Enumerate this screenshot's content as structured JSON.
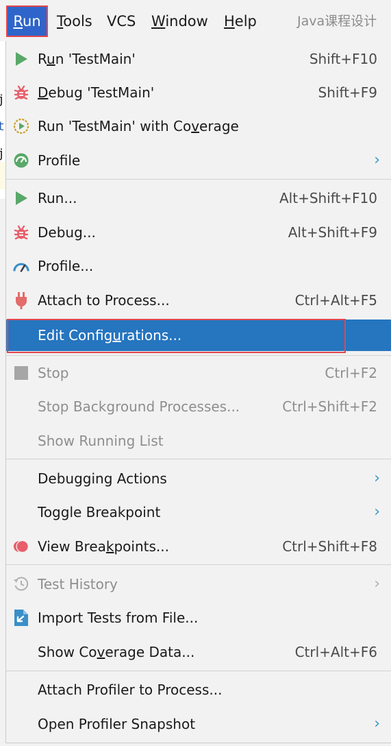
{
  "menubar": {
    "items": [
      {
        "label": "Run",
        "mnemonic": "R",
        "rest": "un"
      },
      {
        "label": "Tools",
        "mnemonic": "T",
        "rest": "ools"
      },
      {
        "label": "VCS"
      },
      {
        "label": "Window",
        "mnemonic": "W",
        "rest": "indow"
      },
      {
        "label": "Help",
        "mnemonic": "H",
        "rest": "elp"
      }
    ],
    "project_title": "Java课程设计"
  },
  "editor_fragments": [
    "j",
    "t",
    "j"
  ],
  "menu": {
    "items": [
      {
        "pre": "R",
        "mn": "u",
        "post": "n 'TestMain'",
        "shortcut": "Shift+F10",
        "icon": "run-icon"
      },
      {
        "pre": "",
        "mn": "D",
        "post": "ebug 'TestMain'",
        "shortcut": "Shift+F9",
        "icon": "debug-icon"
      },
      {
        "pre": "Run 'TestMain' with Co",
        "mn": "v",
        "post": "erage",
        "shortcut": "",
        "icon": "coverage-icon"
      },
      {
        "pre": "Profile",
        "mn": "",
        "post": "",
        "shortcut": "",
        "icon": "profiler-icon",
        "submenu": true
      },
      {
        "pre": "Run...",
        "mn": "",
        "post": "",
        "shortcut": "Alt+Shift+F10",
        "icon": "run-icon"
      },
      {
        "pre": "Debug...",
        "mn": "",
        "post": "",
        "shortcut": "Alt+Shift+F9",
        "icon": "debug-icon"
      },
      {
        "pre": "Profile...",
        "mn": "",
        "post": "",
        "shortcut": "",
        "icon": "gauge-icon"
      },
      {
        "pre": "Attach to Process...",
        "mn": "",
        "post": "",
        "shortcut": "Ctrl+Alt+F5",
        "icon": "plug-icon"
      },
      {
        "pre": "Edit Config",
        "mn": "u",
        "post": "rations...",
        "shortcut": "",
        "icon": "",
        "selected": true
      },
      {
        "pre": "Stop",
        "mn": "",
        "post": "",
        "shortcut": "Ctrl+F2",
        "icon": "stop-icon",
        "disabled": true
      },
      {
        "pre": "Stop Background Processes...",
        "mn": "",
        "post": "",
        "shortcut": "Ctrl+Shift+F2",
        "icon": "",
        "disabled": true
      },
      {
        "pre": "Show Running List",
        "mn": "",
        "post": "",
        "shortcut": "",
        "icon": "",
        "disabled": true
      },
      {
        "pre": "Debugging Actions",
        "mn": "",
        "post": "",
        "shortcut": "",
        "icon": "",
        "submenu": true
      },
      {
        "pre": "Toggle Breakpoint",
        "mn": "",
        "post": "",
        "shortcut": "",
        "icon": "",
        "submenu": true
      },
      {
        "pre": "View Brea",
        "mn": "k",
        "post": "points...",
        "shortcut": "Ctrl+Shift+F8",
        "icon": "breakpoints-icon"
      },
      {
        "pre": "Test History",
        "mn": "",
        "post": "",
        "shortcut": "",
        "icon": "history-icon",
        "submenu": true,
        "disabled": true
      },
      {
        "pre": "Import Tests from File...",
        "mn": "",
        "post": "",
        "shortcut": "",
        "icon": "import-tests-icon"
      },
      {
        "pre": "Show Co",
        "mn": "v",
        "post": "erage Data...",
        "shortcut": "Ctrl+Alt+F6",
        "icon": ""
      },
      {
        "pre": "Attach Profiler to Process...",
        "mn": "",
        "post": "",
        "shortcut": "",
        "icon": ""
      },
      {
        "pre": "Open Profiler Snapshot",
        "mn": "",
        "post": "",
        "shortcut": "",
        "icon": "",
        "submenu": true
      }
    ]
  },
  "colors": {
    "selection": "#2675bf",
    "highlight_frame": "#e2464f",
    "run_green": "#59a869",
    "debug_red": "#e85e6b",
    "chevron_blue": "#3a98c6"
  }
}
